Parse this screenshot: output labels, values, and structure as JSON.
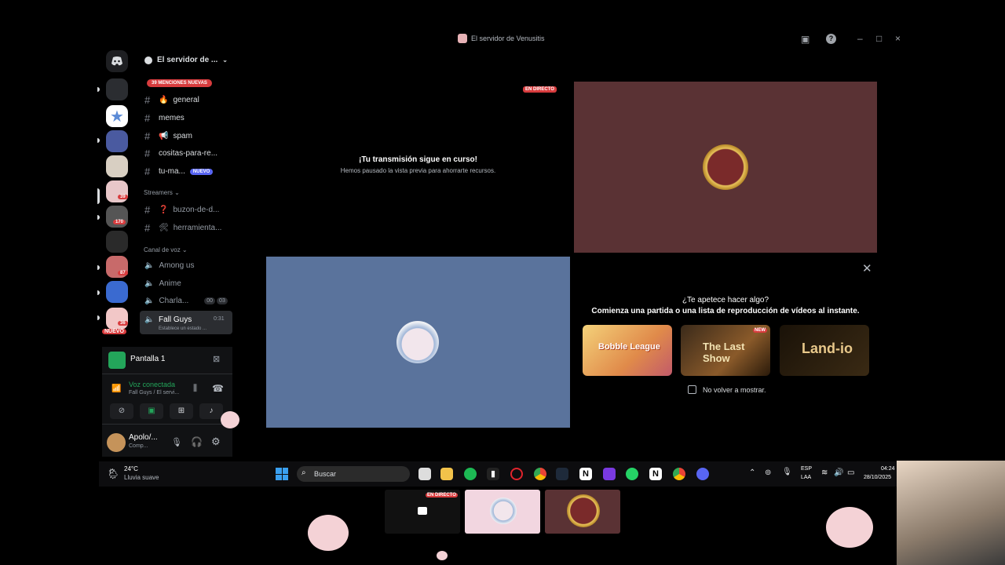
{
  "window": {
    "title": "El servidor de Venusitis"
  },
  "server_header": {
    "name": "El servidor de ..."
  },
  "mentions_badge": "39 MENCIONES NUEVAS",
  "server_badges": [
    "39",
    "170",
    "87",
    "36"
  ],
  "server_new": "NUEVO",
  "text_channels": [
    {
      "icon": "🔥",
      "name": "general"
    },
    {
      "icon": "",
      "name": "memes"
    },
    {
      "icon": "📢",
      "name": "spam"
    },
    {
      "icon": "",
      "name": "cositas-para-re..."
    },
    {
      "icon": "",
      "name": "tu-ma...",
      "badge": "NUEVO"
    }
  ],
  "streamers_category": "Streamers",
  "streamer_channels": [
    {
      "icon": "❓",
      "name": "buzon-de-d..."
    },
    {
      "icon": "🛠",
      "name": "herramienta..."
    }
  ],
  "voice_category": "Canal de voz",
  "voice_channels": [
    {
      "name": "Among us"
    },
    {
      "name": "Anime"
    },
    {
      "name": "Charla...",
      "counts": [
        "00",
        "03"
      ]
    },
    {
      "name": "Fall Guys",
      "time": "0:31",
      "status": "Establece un estado ..."
    }
  ],
  "screen_panel": {
    "label": "Pantalla 1"
  },
  "voice_status": {
    "title": "Voz conectada",
    "subtitle": "Fall Guys / El servi..."
  },
  "user": {
    "name": "Apolo/...",
    "status": "Comp..."
  },
  "stream": {
    "live_label": "EN DIRECTO",
    "paused_title": "¡Tu transmisión sigue en curso!",
    "paused_subtitle": "Hemos pausado la vista previa para ahorrarte recursos."
  },
  "activity": {
    "title": "¿Te apetece hacer algo?",
    "subtitle": "Comienza una partida o una lista de reproducción de vídeos al instante.",
    "games": [
      "Bobble League",
      "The Last Show",
      "Land-io"
    ],
    "new_badge": "NEW",
    "checkbox_label": "No volver a mostrar."
  },
  "taskbar": {
    "weather_temp": "24°C",
    "weather_desc": "Lluvia suave",
    "search_placeholder": "Buscar",
    "lang_top": "ESP",
    "lang_bottom": "LAA",
    "time": "04:24",
    "date": "28/10/2025"
  },
  "thumbnails": {
    "live_label": "EN DIRECTO"
  },
  "colors": {
    "accent": "#5865f2",
    "danger": "#d83c3e",
    "voice_green": "#23a55a"
  }
}
